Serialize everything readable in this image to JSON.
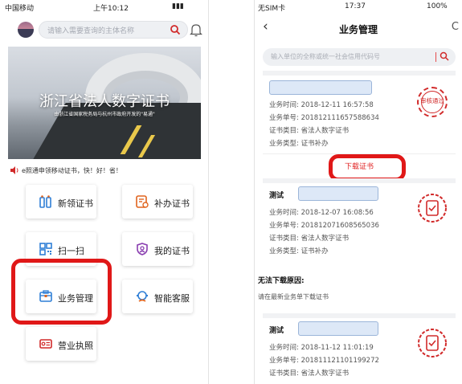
{
  "left_phone": {
    "status": {
      "carrier": "中国移动",
      "time": "上午10:12"
    },
    "search": {
      "placeholder": "请输入需要查询的主体名称"
    },
    "banner": {
      "title": "浙江省法人数字证书",
      "subtitle": "由浙江省国家税务局与杭州市政府开发的\"易通\""
    },
    "notice": "e照通申领移动证书，快！好！省！",
    "tiles": [
      {
        "label": "新领证书",
        "icon": "new-certificate-icon"
      },
      {
        "label": "补办证书",
        "icon": "reissue-certificate-icon"
      },
      {
        "label": "扫一扫",
        "icon": "qr-scan-icon"
      },
      {
        "label": "我的证书",
        "icon": "my-certificate-icon"
      },
      {
        "label": "业务管理",
        "icon": "business-management-icon"
      },
      {
        "label": "智能客服",
        "icon": "smart-service-icon"
      },
      {
        "label": "营业执照",
        "icon": "business-license-icon"
      }
    ],
    "highlight_color": "#e01818"
  },
  "right_phone": {
    "status": {
      "carrier": "无SIM卡",
      "time": "17:37",
      "battery": "100%"
    },
    "nav": {
      "back": "‹",
      "title": "业务管理",
      "refresh": "C"
    },
    "search": {
      "placeholder": "输入单位的全称或统一社会信用代码号"
    },
    "cards": [
      {
        "name_prefix": "",
        "rows": [
          "业务时间: 2018-12-11 16:57:58",
          "业务单号: 201812111657588634",
          "证书类目: 省法人数字证书",
          "业务类型: 证书补办"
        ],
        "stamp": "审核通过",
        "action": "下载证书"
      },
      {
        "name_prefix": "测试",
        "rows": [
          "业务时间: 2018-12-07 16:08:56",
          "业务单号: 201812071608565036",
          "证书类目: 省法人数字证书",
          "业务类型: 证书补办"
        ],
        "stamp": "",
        "failure_label": "无法下载原因:",
        "failure_text": "请在最新业务单下载证书"
      },
      {
        "name_prefix": "测试",
        "rows": [
          "业务时间: 2018-11-12 11:01:19",
          "业务单号: 201811121101199272",
          "证书类目: 省法人数字证书"
        ],
        "stamp": ""
      }
    ]
  }
}
